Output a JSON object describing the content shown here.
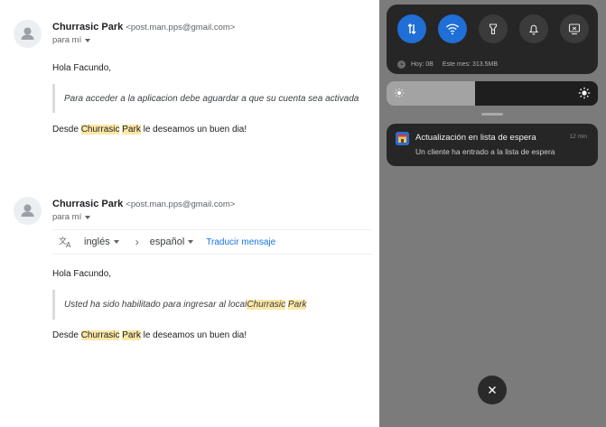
{
  "emails": [
    {
      "sender_name": "Churrasic Park",
      "sender_address": "<post.man.pps@gmail.com>",
      "recipient": "para mí",
      "greeting": "Hola Facundo,",
      "quote": "Para acceder a la aplicacion debe aguardar a que su cuenta sea activada",
      "signoff_prefix": "Desde ",
      "signoff_hl1": "Churrasic",
      "signoff_hl2": "Park",
      "signoff_suffix": " le deseamos un buen dia!"
    },
    {
      "sender_name": "Churrasic Park",
      "sender_address": "<post.man.pps@gmail.com>",
      "recipient": "para mí",
      "translate": {
        "source_lang": "inglés",
        "target_lang": "español",
        "action": "Traducir mensaje"
      },
      "greeting": "Hola Facundo,",
      "quote_prefix": "Usted ha sido habilitado para ingresar al local ",
      "quote_hl1": "Churrasic",
      "quote_hl2": "Park",
      "signoff_prefix": "Desde ",
      "signoff_hl1": "Churrasic",
      "signoff_hl2": "Park",
      "signoff_suffix": " le deseamos un buen dia!"
    }
  ],
  "quick_settings": {
    "tiles": [
      {
        "icon": "mobile-data-icon",
        "active": true
      },
      {
        "icon": "wifi-icon",
        "active": true
      },
      {
        "icon": "flashlight-icon",
        "active": false
      },
      {
        "icon": "bell-icon",
        "active": false
      },
      {
        "icon": "screencast-icon",
        "active": false
      }
    ],
    "usage_today": "Hoy: 0B",
    "usage_month": "Este mes: 313.5MB",
    "brightness_level": 0.42
  },
  "notification": {
    "title": "Actualización en lista de espera",
    "time": "12 min",
    "message": "Un cliente ha entrado a la lista de espera"
  },
  "colors": {
    "highlight": "#fce8a6",
    "active_tile": "#1f6fd6",
    "link": "#1a73e8"
  }
}
